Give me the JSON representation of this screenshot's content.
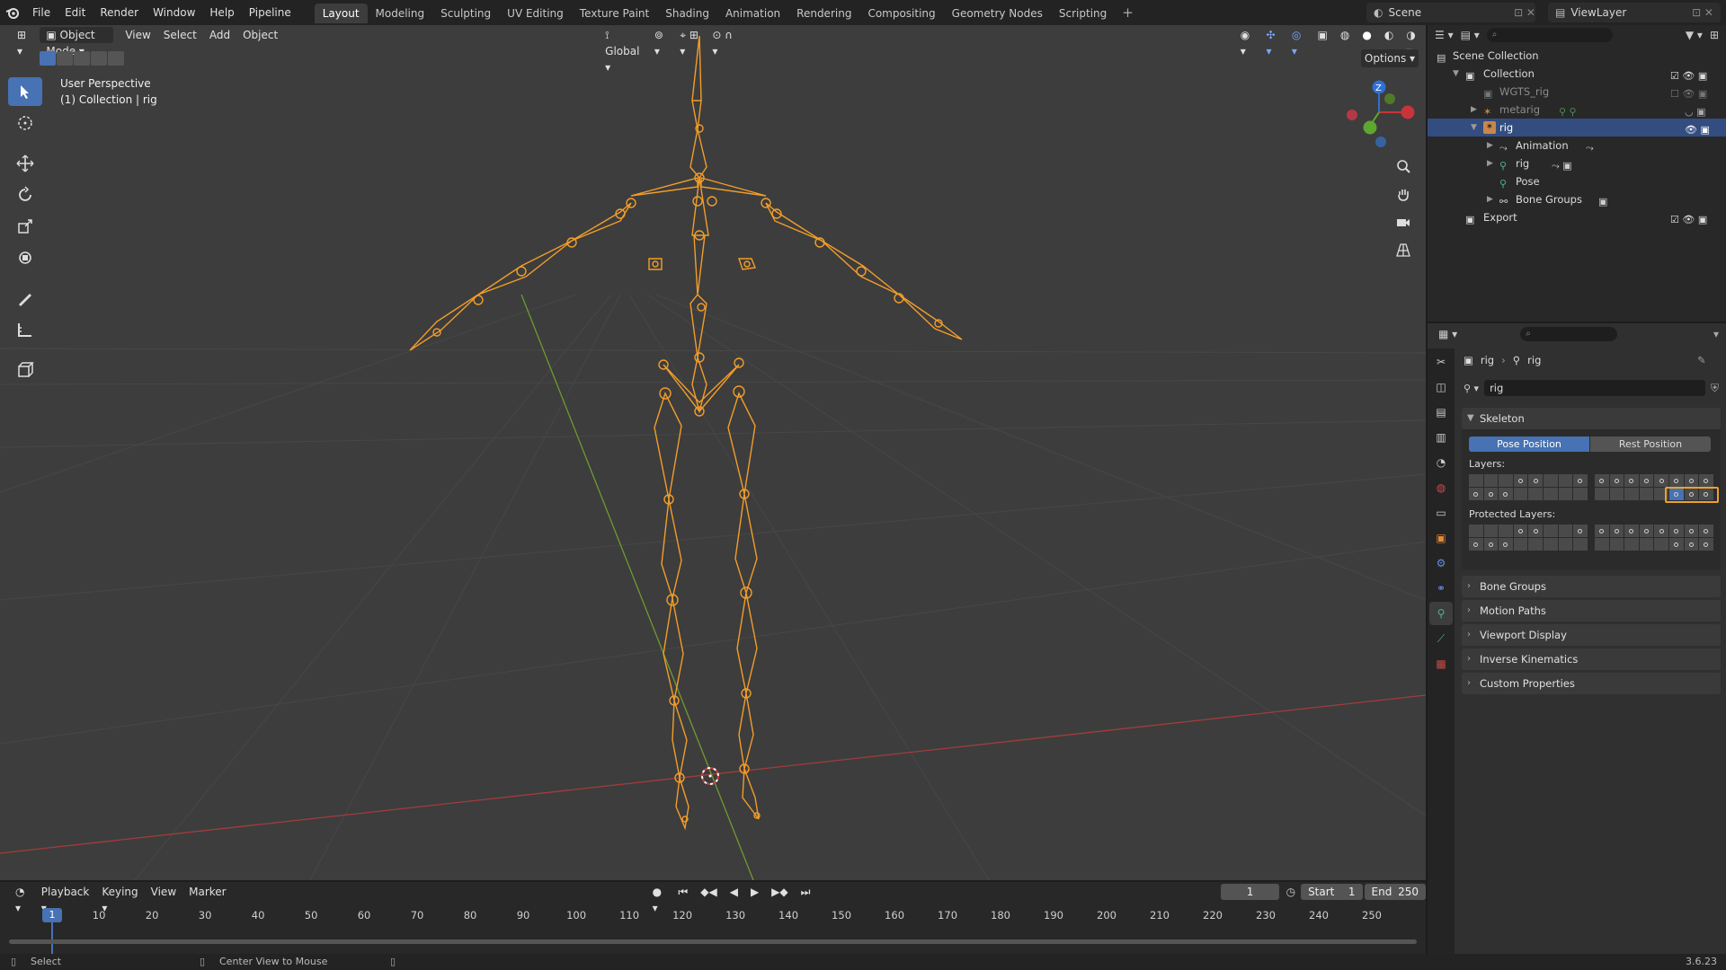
{
  "menubar": {
    "menus": [
      "File",
      "Edit",
      "Render",
      "Window",
      "Help",
      "Pipeline"
    ],
    "workspaces": [
      "Layout",
      "Modeling",
      "Sculpting",
      "UV Editing",
      "Texture Paint",
      "Shading",
      "Animation",
      "Rendering",
      "Compositing",
      "Geometry Nodes",
      "Scripting"
    ],
    "active_workspace": "Layout",
    "scene": "Scene",
    "view_layer": "ViewLayer"
  },
  "viewport": {
    "mode": "Object Mode",
    "menus": [
      "View",
      "Select",
      "Add",
      "Object"
    ],
    "orientation": "Global",
    "options_label": "Options",
    "overlay_line1": "User Perspective",
    "overlay_line2": "(1) Collection | rig",
    "gizmo_z": "Z",
    "colors": {
      "bone": "#f29d2a",
      "x_axis": "#a33c3c",
      "y_axis": "#6e9a30",
      "grid": "#4a4a4a"
    }
  },
  "outliner": {
    "rows": [
      {
        "label": "Scene Collection"
      },
      {
        "label": "Collection"
      },
      {
        "label": "WGTS_rig"
      },
      {
        "label": "metarig"
      },
      {
        "label": "rig"
      },
      {
        "label": "Animation"
      },
      {
        "label": "rig"
      },
      {
        "label": "Pose"
      },
      {
        "label": "Bone Groups"
      },
      {
        "label": "Export"
      }
    ]
  },
  "properties": {
    "breadcrumb_a": "rig",
    "breadcrumb_b": "rig",
    "data_name": "rig",
    "skeleton_label": "Skeleton",
    "pose_position": "Pose Position",
    "rest_position": "Rest Position",
    "layers_label": "Layers:",
    "protected_label": "Protected Layers:",
    "panels": [
      "Bone Groups",
      "Motion Paths",
      "Viewport Display",
      "Inverse Kinematics",
      "Custom Properties"
    ]
  },
  "timeline": {
    "menus": [
      "Playback",
      "Keying",
      "View",
      "Marker"
    ],
    "current_frame": "1",
    "start_label": "Start",
    "start": "1",
    "end_label": "End",
    "end": "250",
    "ticks": [
      "1",
      "10",
      "20",
      "30",
      "40",
      "50",
      "60",
      "70",
      "80",
      "90",
      "100",
      "110",
      "120",
      "130",
      "140",
      "150",
      "160",
      "170",
      "180",
      "190",
      "200",
      "210",
      "220",
      "230",
      "240",
      "250"
    ]
  },
  "statusbar": {
    "left": "Select",
    "middle": "Center View to Mouse",
    "version": "3.6.23"
  }
}
